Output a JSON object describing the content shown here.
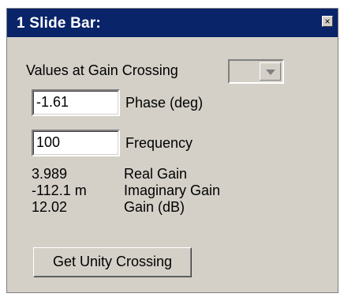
{
  "window": {
    "title": "1  Slide Bar:",
    "close_glyph": "×"
  },
  "gain_crossing": {
    "label": "Values at Gain Crossing",
    "selected": ""
  },
  "phase": {
    "value": "-1.61",
    "label": "Phase (deg)"
  },
  "frequency": {
    "value": "100",
    "label": "Frequency"
  },
  "results": [
    {
      "value": "3.989",
      "label": "Real Gain"
    },
    {
      "value": "-112.1 m",
      "label": "Imaginary Gain"
    },
    {
      "value": "12.02",
      "label": "Gain (dB)"
    }
  ],
  "buttons": {
    "unity": "Get Unity Crossing"
  }
}
